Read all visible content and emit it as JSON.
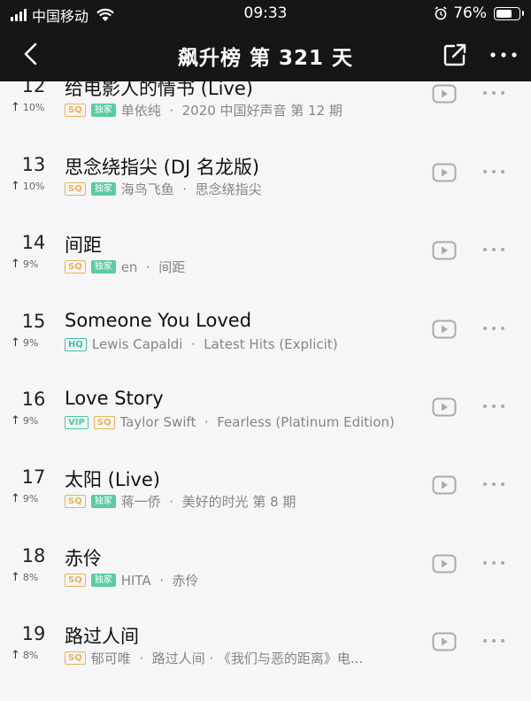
{
  "status_bar": {
    "carrier": "中国移动",
    "time": "09:33",
    "battery": "76%",
    "battery_level": 0.76
  },
  "nav": {
    "title": "飙升榜 第 321 天",
    "icons": [
      "back-icon",
      "share-icon",
      "more-icon"
    ]
  },
  "colors": {
    "header_bg": "#161617",
    "page_bg": "#f6f6f8",
    "sq": "#e7b454",
    "exclusive": "#5ccba0",
    "hq": "#3fbfa7"
  },
  "songs": [
    {
      "rank": "12",
      "change": "10%",
      "title": "给电影人的情书 (Live)",
      "badges": [
        "SQ",
        "独家"
      ],
      "artist": "单依纯",
      "album": "2020 中国好声音 第 12 期"
    },
    {
      "rank": "13",
      "change": "10%",
      "title": "思念绕指尖 (DJ 名龙版)",
      "badges": [
        "SQ",
        "独家"
      ],
      "artist": "海鸟飞鱼",
      "album": "思念绕指尖"
    },
    {
      "rank": "14",
      "change": "9%",
      "title": "间距",
      "badges": [
        "SQ",
        "独家"
      ],
      "artist": "en",
      "album": "间距"
    },
    {
      "rank": "15",
      "change": "9%",
      "title": "Someone You Loved",
      "badges": [
        "HQ"
      ],
      "artist": "Lewis Capaldi",
      "album": "Latest Hits (Explicit)"
    },
    {
      "rank": "16",
      "change": "9%",
      "title": "Love Story",
      "badges": [
        "VIP",
        "SQ"
      ],
      "artist": "Taylor Swift",
      "album": "Fearless (Platinum Edition)"
    },
    {
      "rank": "17",
      "change": "9%",
      "title": "太阳 (Live)",
      "badges": [
        "SQ",
        "独家"
      ],
      "artist": "蒋一侨",
      "album": "美好的时光 第 8 期"
    },
    {
      "rank": "18",
      "change": "8%",
      "title": "赤伶",
      "badges": [
        "SQ",
        "独家"
      ],
      "artist": "HITA",
      "album": "赤伶"
    },
    {
      "rank": "19",
      "change": "8%",
      "title": "路过人间",
      "badges": [
        "SQ"
      ],
      "artist": "郁可唯",
      "album": "路过人间 · 《我们与恶的距离》电..."
    }
  ]
}
